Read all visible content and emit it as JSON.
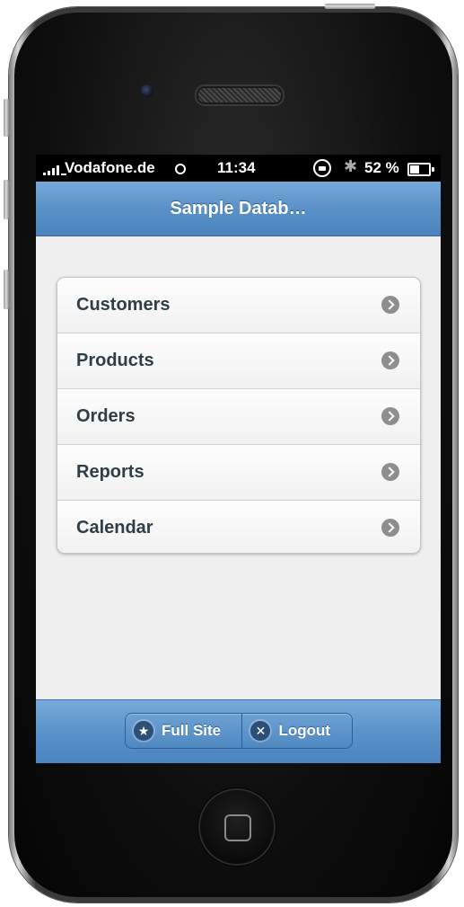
{
  "status_bar": {
    "carrier": "Vodafone.de",
    "time": "11:34",
    "battery_percent": "52 %",
    "icons": [
      "signal-icon",
      "activity-icon",
      "rotation-lock-icon",
      "bluetooth-icon",
      "battery-icon"
    ]
  },
  "header": {
    "title": "Sample Datab…"
  },
  "menu": {
    "items": [
      {
        "label": "Customers",
        "icon": "chevron-right-icon"
      },
      {
        "label": "Products",
        "icon": "chevron-right-icon"
      },
      {
        "label": "Orders",
        "icon": "chevron-right-icon"
      },
      {
        "label": "Reports",
        "icon": "chevron-right-icon"
      },
      {
        "label": "Calendar",
        "icon": "chevron-right-icon"
      }
    ]
  },
  "footer": {
    "full_site_label": "Full Site",
    "full_site_icon": "star-icon",
    "logout_label": "Logout",
    "logout_icon": "close-icon"
  },
  "colors": {
    "header_blue": "#5a91c8",
    "list_text": "#2f3e46",
    "screen_bg": "#efefef"
  }
}
